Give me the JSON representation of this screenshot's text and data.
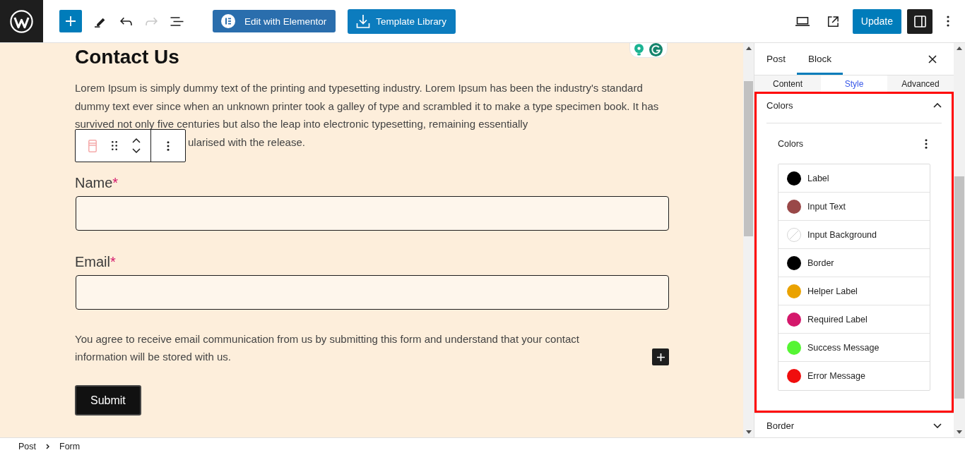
{
  "top_bar": {
    "history": [
      {
        "kind": "undo",
        "disabled": false
      },
      {
        "kind": "redo",
        "disabled": true
      }
    ],
    "buttons": [
      {
        "kind": "elementor",
        "label": "Edit with Elementor"
      },
      {
        "kind": "library",
        "label": "Template Library"
      }
    ],
    "update_button": "Update",
    "settings_toggle": {
      "pressed": true
    }
  },
  "canvas": {
    "heading": "Contact Us",
    "intro": {
      "text": "Lorem Ipsum is simply dummy text of the printing and typesetting industry. Lorem Ipsum has been the industry's standard dummy text ever since when an unknown printer took a galley of type and scrambled it to make a type specimen book. It has survived not only five centuries but also the leap into electronic typesetting, remaining essentially",
      "continuation": "ularised with the release."
    },
    "fields": [
      {
        "label": "Name",
        "required_mark": "*"
      },
      {
        "label": "Email",
        "required_mark": "*"
      }
    ],
    "consent": "You agree to receive email communication from us by submitting this form and understand that your contact information will be stored with us.",
    "submit": "Submit"
  },
  "sidebar": {
    "tabs": [
      {
        "label": "Post",
        "selected": false
      },
      {
        "label": "Block",
        "selected": true
      }
    ],
    "style_tabs": [
      {
        "label": "Content",
        "selected": false
      },
      {
        "label": "Style",
        "selected": true
      },
      {
        "label": "Advanced",
        "selected": false
      }
    ],
    "panels": [
      {
        "title": "Colors",
        "expanded": true,
        "highlighted": true,
        "group": {
          "title": "Colors",
          "items": [
            {
              "name": "Label",
              "kind": "solid",
              "color": "#000000"
            },
            {
              "name": "Input Text",
              "kind": "solid",
              "color": "#994848"
            },
            {
              "name": "Input Background",
              "kind": "empty"
            },
            {
              "name": "Border",
              "kind": "solid",
              "color": "#000000"
            },
            {
              "name": "Helper Label",
              "kind": "solid",
              "color": "#eaa200"
            },
            {
              "name": "Required Label",
              "kind": "solid",
              "color": "#d4186b"
            },
            {
              "name": "Success Message",
              "kind": "solid",
              "color": "#55f533"
            },
            {
              "name": "Error Message",
              "kind": "solid",
              "color": "#f00e0e"
            }
          ]
        }
      },
      {
        "title": "Border",
        "expanded": false,
        "highlighted": false
      }
    ]
  },
  "breadcrumbs": [
    "Post",
    "Form"
  ]
}
